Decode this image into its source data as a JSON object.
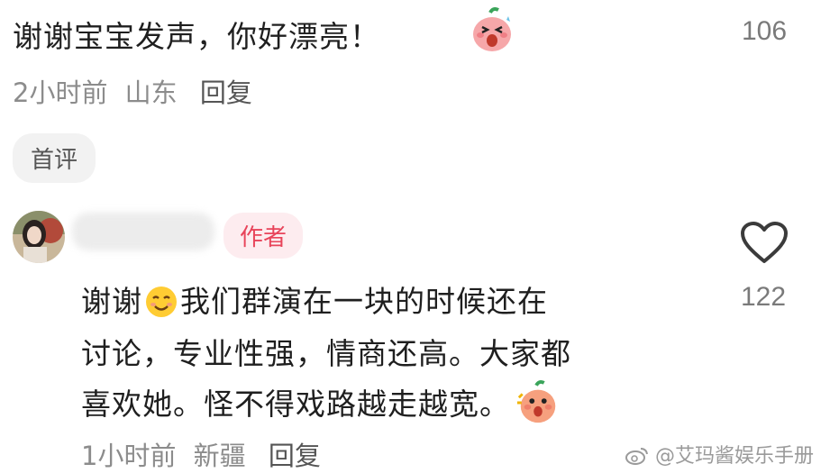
{
  "comment1": {
    "text": "谢谢宝宝发声，你好漂亮！",
    "emoji_icon": "peach-mascot-emoji",
    "like_count": "106",
    "time": "2小时前",
    "location": "山东",
    "reply_label": "回复",
    "tag": "首评"
  },
  "comment2": {
    "author_badge": "作者",
    "line1_a": "谢谢",
    "line1_b": "我们群演在一块的时候还在",
    "line2": "讨论，专业性强，情商还高。大家都",
    "line3": "喜欢她。怪不得戏路越走越宽。",
    "like_count": "122",
    "time": "1小时前",
    "location": "新疆",
    "reply_label": "回复",
    "inline_emoji": "smiling-face-emoji",
    "end_emoji": "peach-mascot-emoji"
  },
  "watermark": {
    "text": "@艾玛酱娱乐手册"
  },
  "colors": {
    "badge_bg": "#fdecef",
    "badge_text": "#e8445a",
    "meta_text": "#8c8c8c"
  }
}
